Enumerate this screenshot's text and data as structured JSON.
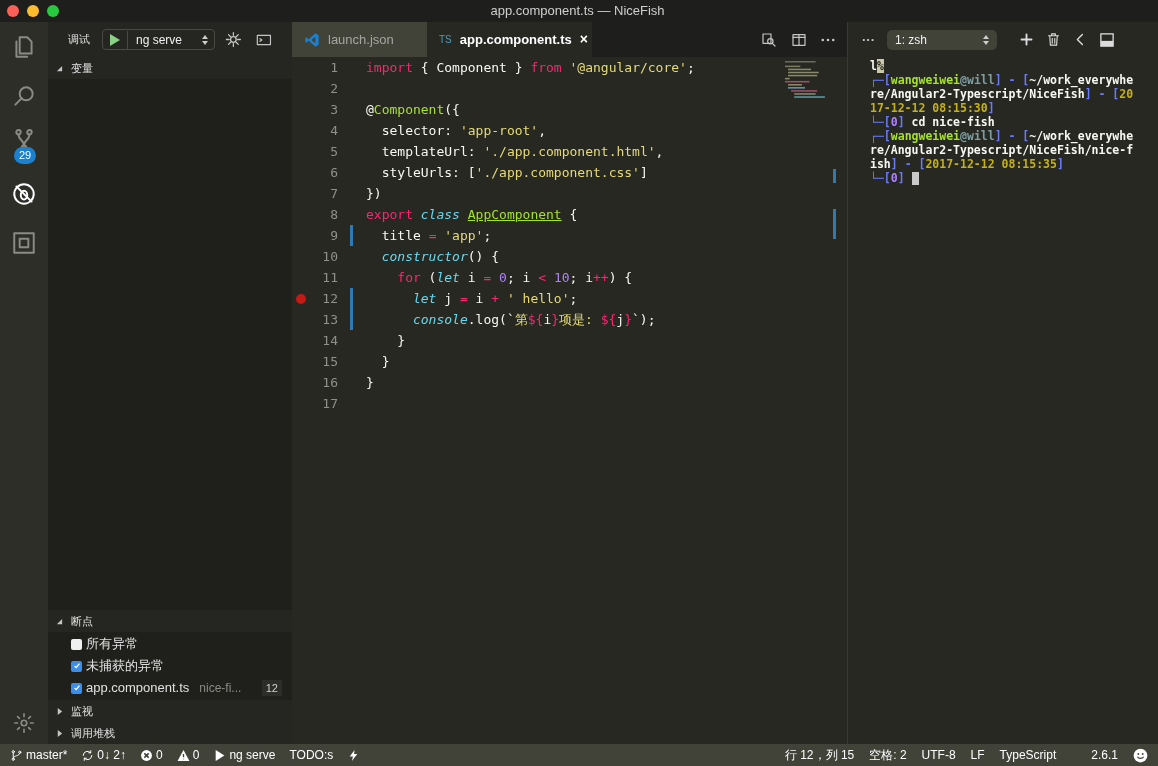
{
  "window": {
    "title": "app.component.ts — NiceFish"
  },
  "activity_bar": {
    "items": [
      {
        "kind": "files",
        "selected": false
      },
      {
        "kind": "search",
        "selected": false
      },
      {
        "kind": "git",
        "selected": false,
        "badge": "29"
      },
      {
        "kind": "debug",
        "selected": true
      },
      {
        "kind": "extensions",
        "selected": false
      }
    ]
  },
  "debug_toolbar": {
    "label": "调试",
    "configuration": "ng serve"
  },
  "sidebar": {
    "variables": {
      "title": "变量",
      "expanded": true
    },
    "breakpoints": {
      "title": "断点",
      "expanded": true,
      "items": [
        {
          "label": "所有异常",
          "checked": false
        },
        {
          "label": "未捕获的异常",
          "checked": true
        },
        {
          "label": "app.component.ts",
          "checked": true,
          "path": "nice-fi...",
          "line": "12"
        }
      ]
    },
    "watch": {
      "title": "监视",
      "expanded": false
    },
    "call_stack": {
      "title": "调用堆栈",
      "expanded": false
    }
  },
  "tabs": [
    {
      "label": "launch.json",
      "kind": "json",
      "selected": false
    },
    {
      "label": "app.component.ts",
      "kind": "ts",
      "icon_text": "TS",
      "selected": true,
      "close": "×"
    }
  ],
  "editor": {
    "lines": [
      {
        "n": "1",
        "modified": false,
        "breakpoint": false,
        "tokens": [
          {
            "t": "import ",
            "kind": "keyword"
          },
          {
            "t": "{ Component } ",
            "kind": "plain"
          },
          {
            "t": "from ",
            "kind": "keyword"
          },
          {
            "t": "'@angular/core'",
            "kind": "string"
          },
          {
            "t": ";",
            "kind": "plain"
          }
        ]
      },
      {
        "n": "2",
        "modified": false,
        "breakpoint": false
      },
      {
        "n": "3",
        "modified": false,
        "breakpoint": false,
        "tokens": [
          {
            "t": "@",
            "kind": "plain"
          },
          {
            "t": "Component",
            "kind": "function"
          },
          {
            "t": "({",
            "kind": "plain"
          }
        ]
      },
      {
        "n": "4",
        "modified": false,
        "breakpoint": false,
        "tokens": [
          {
            "t": "  selector: ",
            "kind": "plain"
          },
          {
            "t": "'app-root'",
            "kind": "string"
          },
          {
            "t": ",",
            "kind": "plain"
          }
        ]
      },
      {
        "n": "5",
        "modified": false,
        "breakpoint": false,
        "tokens": [
          {
            "t": "  templateUrl: ",
            "kind": "plain"
          },
          {
            "t": "'./app.component.html'",
            "kind": "string"
          },
          {
            "t": ",",
            "kind": "plain"
          }
        ]
      },
      {
        "n": "6",
        "modified": false,
        "breakpoint": false,
        "tokens": [
          {
            "t": "  styleUrls: [",
            "kind": "plain"
          },
          {
            "t": "'./app.component.css'",
            "kind": "string"
          },
          {
            "t": "]",
            "kind": "plain"
          }
        ]
      },
      {
        "n": "7",
        "modified": false,
        "breakpoint": false,
        "tokens": [
          {
            "t": "})",
            "kind": "plain"
          }
        ]
      },
      {
        "n": "8",
        "modified": false,
        "breakpoint": false,
        "tokens": [
          {
            "t": "export ",
            "kind": "keyword"
          },
          {
            "t": "class ",
            "kind": "storage"
          },
          {
            "t": "AppComponent",
            "kind": "class"
          },
          {
            "t": " {",
            "kind": "plain"
          }
        ]
      },
      {
        "n": "9",
        "modified": true,
        "breakpoint": false,
        "tokens": [
          {
            "t": "  title ",
            "kind": "plain"
          },
          {
            "t": "= ",
            "kind": "keyword"
          },
          {
            "t": "'app'",
            "kind": "string"
          },
          {
            "t": ";",
            "kind": "plain"
          }
        ]
      },
      {
        "n": "10",
        "modified": false,
        "breakpoint": false,
        "tokens": [
          {
            "t": "  constructor",
            "kind": "storage"
          },
          {
            "t": "() {",
            "kind": "plain"
          }
        ]
      },
      {
        "n": "11",
        "modified": false,
        "breakpoint": false,
        "tokens": [
          {
            "t": "    for",
            "kind": "keyword"
          },
          {
            "t": " (",
            "kind": "plain"
          },
          {
            "t": "let",
            "kind": "storage"
          },
          {
            "t": " i ",
            "kind": "plain"
          },
          {
            "t": "= ",
            "kind": "keyword"
          },
          {
            "t": "0",
            "kind": "number"
          },
          {
            "t": "; i ",
            "kind": "plain"
          },
          {
            "t": "< ",
            "kind": "keyword"
          },
          {
            "t": "10",
            "kind": "number"
          },
          {
            "t": "; i",
            "kind": "plain"
          },
          {
            "t": "++",
            "kind": "keyword"
          },
          {
            "t": ") {",
            "kind": "plain"
          }
        ]
      },
      {
        "n": "12",
        "modified": true,
        "breakpoint": true,
        "tokens": [
          {
            "t": "      let",
            "kind": "storage"
          },
          {
            "t": " j ",
            "kind": "plain"
          },
          {
            "t": "=",
            "kind": "keyword"
          },
          {
            "t": " i ",
            "kind": "plain"
          },
          {
            "t": "+",
            "kind": "keyword"
          },
          {
            "t": " ' hello'",
            "kind": "string"
          },
          {
            "t": ";",
            "kind": "plain"
          }
        ]
      },
      {
        "n": "13",
        "modified": true,
        "breakpoint": false,
        "tokens": [
          {
            "t": "      console",
            "kind": "storage"
          },
          {
            "t": ".log(`",
            "kind": "plain"
          },
          {
            "t": "第",
            "kind": "string"
          },
          {
            "t": "${",
            "kind": "keyword"
          },
          {
            "t": "i",
            "kind": "plain"
          },
          {
            "t": "}",
            "kind": "keyword"
          },
          {
            "t": "项是: ",
            "kind": "string"
          },
          {
            "t": "${",
            "kind": "keyword"
          },
          {
            "t": "j",
            "kind": "plain"
          },
          {
            "t": "}",
            "kind": "keyword"
          },
          {
            "t": "`);",
            "kind": "plain"
          }
        ]
      },
      {
        "n": "14",
        "modified": false,
        "breakpoint": false,
        "tokens": [
          {
            "t": "    }",
            "kind": "plain"
          }
        ]
      },
      {
        "n": "15",
        "modified": false,
        "breakpoint": false,
        "tokens": [
          {
            "t": "  }",
            "kind": "plain"
          }
        ]
      },
      {
        "n": "16",
        "modified": false,
        "breakpoint": false,
        "tokens": [
          {
            "t": "}",
            "kind": "plain"
          }
        ]
      },
      {
        "n": "17",
        "modified": false,
        "breakpoint": false
      }
    ]
  },
  "terminal": {
    "more": "···",
    "selector": "1: zsh",
    "cursor": true,
    "lines": [
      [
        {
          "t": "l",
          "kind": "plain"
        },
        {
          "t": "%",
          "kind": "highlight"
        }
      ],
      [
        {
          "t": "┌─[",
          "kind": "bracket"
        },
        {
          "t": "wangweiwei",
          "kind": "user"
        },
        {
          "t": "@will",
          "kind": "host"
        },
        {
          "t": "] - [",
          "kind": "bracket"
        },
        {
          "t": "~/work_everywhe",
          "kind": "path"
        }
      ],
      [
        {
          "t": "re/Angular2-Typescript/NiceFish",
          "kind": "path"
        },
        {
          "t": "] - [",
          "kind": "bracket"
        },
        {
          "t": "20",
          "kind": "date"
        }
      ],
      [
        {
          "t": "17-12-12 08:15:30",
          "kind": "date"
        },
        {
          "t": "]",
          "kind": "bracket"
        }
      ],
      [
        {
          "t": "└─[",
          "kind": "bracket"
        },
        {
          "t": "0",
          "kind": "code"
        },
        {
          "t": "]",
          "kind": "bracket"
        },
        {
          "t": " cd nice-fish",
          "kind": "plain"
        }
      ],
      [
        {
          "t": "┌─[",
          "kind": "bracket"
        },
        {
          "t": "wangweiwei",
          "kind": "user"
        },
        {
          "t": "@will",
          "kind": "host"
        },
        {
          "t": "] - [",
          "kind": "bracket"
        },
        {
          "t": "~/work_everywhe",
          "kind": "path"
        }
      ],
      [
        {
          "t": "re/Angular2-Typescript/NiceFish/nice-f",
          "kind": "path"
        }
      ],
      [
        {
          "t": "ish",
          "kind": "path"
        },
        {
          "t": "] - [",
          "kind": "bracket"
        },
        {
          "t": "2017-12-12 08:15:35",
          "kind": "date"
        },
        {
          "t": "]",
          "kind": "bracket"
        }
      ],
      [
        {
          "t": "└─[",
          "kind": "bracket"
        },
        {
          "t": "0",
          "kind": "code"
        },
        {
          "t": "]",
          "kind": "bracket"
        }
      ]
    ]
  },
  "status_bar": {
    "left": [
      {
        "kind": "branch",
        "text": "master*"
      },
      {
        "kind": "sync",
        "text": "0↓ 2↑"
      },
      {
        "kind": "error",
        "text": "0"
      },
      {
        "kind": "warning",
        "text": "0"
      },
      {
        "kind": "play",
        "text": "ng serve"
      },
      {
        "kind": "text",
        "text": "TODO:s"
      },
      {
        "kind": "bolt"
      }
    ],
    "right": [
      {
        "kind": "text",
        "text": "行 12，列 15"
      },
      {
        "kind": "text",
        "text": "空格: 2"
      },
      {
        "kind": "text",
        "text": "UTF-8"
      },
      {
        "kind": "text",
        "text": "LF"
      },
      {
        "kind": "text",
        "text": "TypeScript"
      },
      {
        "kind": "text",
        "text": "2.6.1"
      },
      {
        "kind": "smiley"
      }
    ]
  }
}
